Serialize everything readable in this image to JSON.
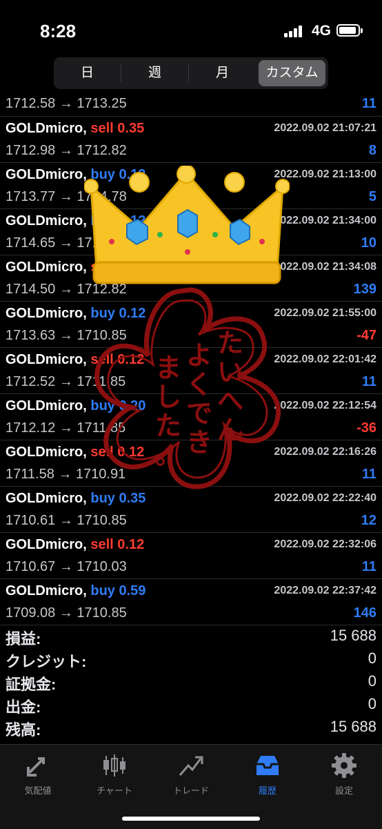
{
  "status_bar": {
    "time": "8:28",
    "network": "4G"
  },
  "period_tabs": [
    "日",
    "週",
    "月",
    "カスタム"
  ],
  "first_row": {
    "prices": "1712.58 → 1713.25",
    "profit": "11"
  },
  "trades": [
    {
      "symbol": "GOLDmicro,",
      "side": "sell",
      "volume": "0.35",
      "date": "2022.09.02 21:07:21",
      "prices": "1712.98 → 1712.82",
      "profit": "8"
    },
    {
      "symbol": "GOLDmicro,",
      "side": "buy",
      "volume": "0.12",
      "date": "2022.09.02 21:13:00",
      "prices": "1713.77 → 1714.78",
      "profit": "5"
    },
    {
      "symbol": "GOLDmicro,",
      "side": "buy",
      "volume": "0.12",
      "date": "2022.09.02 21:34:00",
      "prices": "1714.65 → 1714.74",
      "profit": "10"
    },
    {
      "symbol": "GOLDmicro,",
      "side": "sell",
      "volume": "0.59",
      "date": "2022.09.02 21:34:08",
      "prices": "1714.50 → 1712.82",
      "profit": "139"
    },
    {
      "symbol": "GOLDmicro,",
      "side": "buy",
      "volume": "0.12",
      "date": "2022.09.02 21:55:00",
      "prices": "1713.63 → 1710.85",
      "profit": "-47"
    },
    {
      "symbol": "GOLDmicro,",
      "side": "sell",
      "volume": "0.12",
      "date": "2022.09.02 22:01:42",
      "prices": "1712.52 → 1711.85",
      "profit": "11"
    },
    {
      "symbol": "GOLDmicro,",
      "side": "buy",
      "volume": "0.20",
      "date": "2022.09.02 22:12:54",
      "prices": "1712.12 → 1711.85",
      "profit": "-36"
    },
    {
      "symbol": "GOLDmicro,",
      "side": "sell",
      "volume": "0.12",
      "date": "2022.09.02 22:16:26",
      "prices": "1711.58 → 1710.91",
      "profit": "11"
    },
    {
      "symbol": "GOLDmicro,",
      "side": "buy",
      "volume": "0.35",
      "date": "2022.09.02 22:22:40",
      "prices": "1710.61 → 1710.85",
      "profit": "12"
    },
    {
      "symbol": "GOLDmicro,",
      "side": "sell",
      "volume": "0.12",
      "date": "2022.09.02 22:32:06",
      "prices": "1710.67 → 1710.03",
      "profit": "11"
    },
    {
      "symbol": "GOLDmicro,",
      "side": "buy",
      "volume": "0.59",
      "date": "2022.09.02 22:37:42",
      "prices": "1709.08 → 1710.85",
      "profit": "146"
    }
  ],
  "summary": [
    {
      "label": "損益:",
      "value": "15 688"
    },
    {
      "label": "クレジット:",
      "value": "0"
    },
    {
      "label": "証拠金:",
      "value": "0"
    },
    {
      "label": "出金:",
      "value": "0"
    },
    {
      "label": "残高:",
      "value": "15 688"
    }
  ],
  "tabbar": [
    {
      "label": "気配値",
      "icon": "quotes-arrows-icon"
    },
    {
      "label": "チャート",
      "icon": "candlestick-chart-icon"
    },
    {
      "label": "トレード",
      "icon": "trade-chart-icon"
    },
    {
      "label": "履歴",
      "icon": "history-inbox-icon",
      "active": true
    },
    {
      "label": "設定",
      "icon": "gear-icon"
    }
  ],
  "sticker_text": "たいへんよくできました。",
  "colors": {
    "sell": "#ff3b30",
    "buy": "#2f7cf6",
    "accent": "#2f7cf6"
  }
}
